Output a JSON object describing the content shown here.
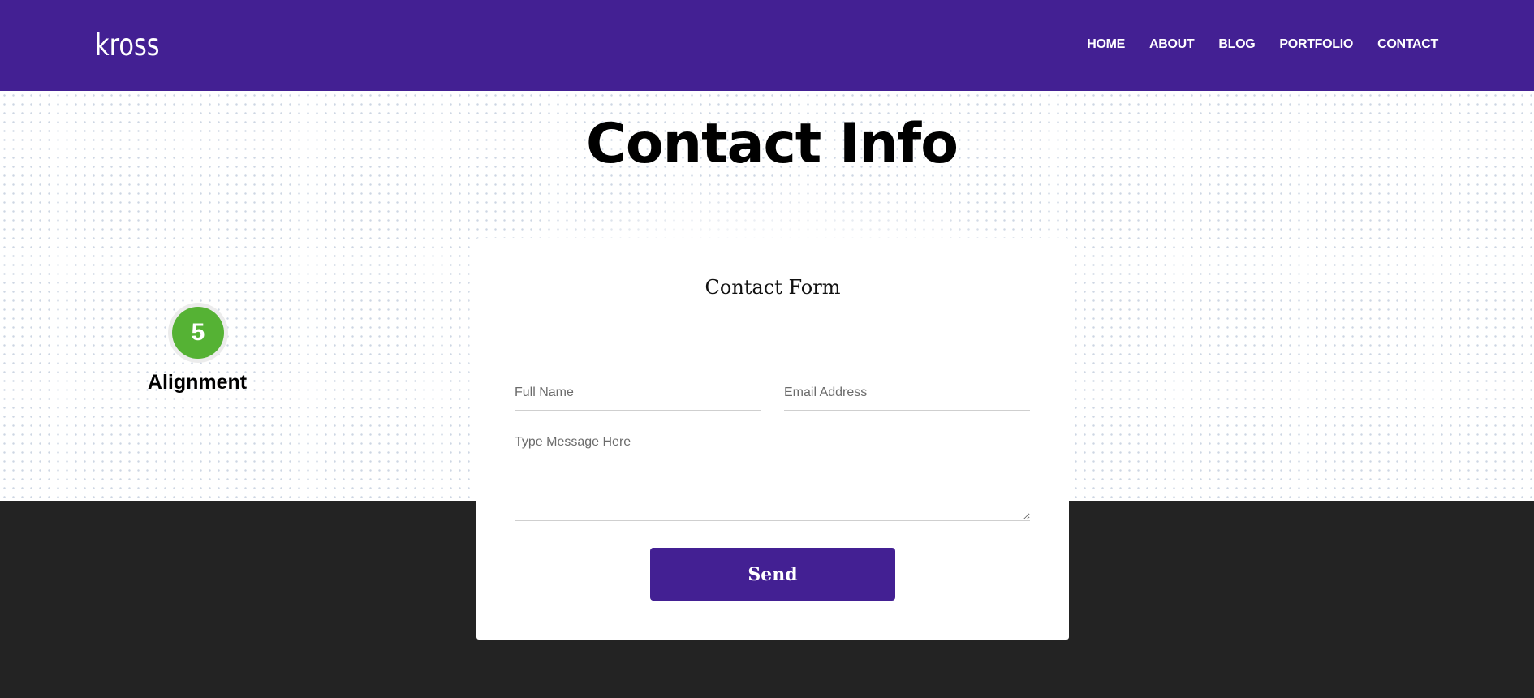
{
  "header": {
    "logo": "kross",
    "nav": [
      "HOME",
      "ABOUT",
      "BLOG",
      "PORTFOLIO",
      "CONTACT"
    ]
  },
  "hero": {
    "title": "Contact Info"
  },
  "step": {
    "number": "5",
    "label": "Alignment"
  },
  "form": {
    "title": "Contact Form",
    "name_placeholder": "Full Name",
    "email_placeholder": "Email Address",
    "message_placeholder": "Type Message Here",
    "send_label": "Send"
  },
  "colors": {
    "brand": "#432093",
    "badge": "#55b234",
    "footer": "#232323"
  }
}
